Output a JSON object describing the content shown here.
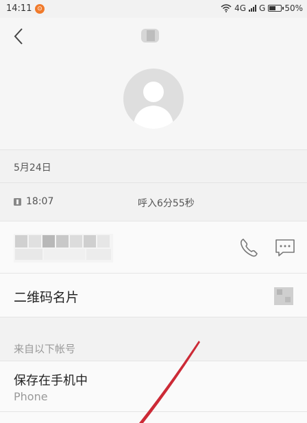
{
  "status_bar": {
    "time": "14:11",
    "notification_badge": "⊙",
    "network_1": "4G",
    "network_2": "G",
    "battery": "50%",
    "battery_level": 0.5
  },
  "history": {
    "date": "5月24日",
    "call_time": "18:07",
    "call_info": "呼入6分55秒"
  },
  "qr": {
    "label": "二维码名片"
  },
  "accounts": {
    "section_title": "来自以下帐号",
    "storage_title": "保存在手机中",
    "storage_sub": "Phone"
  },
  "colors": {
    "background": "#f2f2f2",
    "annotation": "#cc2a36",
    "notification": "#f07a2b"
  },
  "icons": [
    "back-arrow-icon",
    "phone-icon",
    "message-icon",
    "sim-icon",
    "wifi-icon",
    "signal-icon",
    "battery-icon"
  ]
}
